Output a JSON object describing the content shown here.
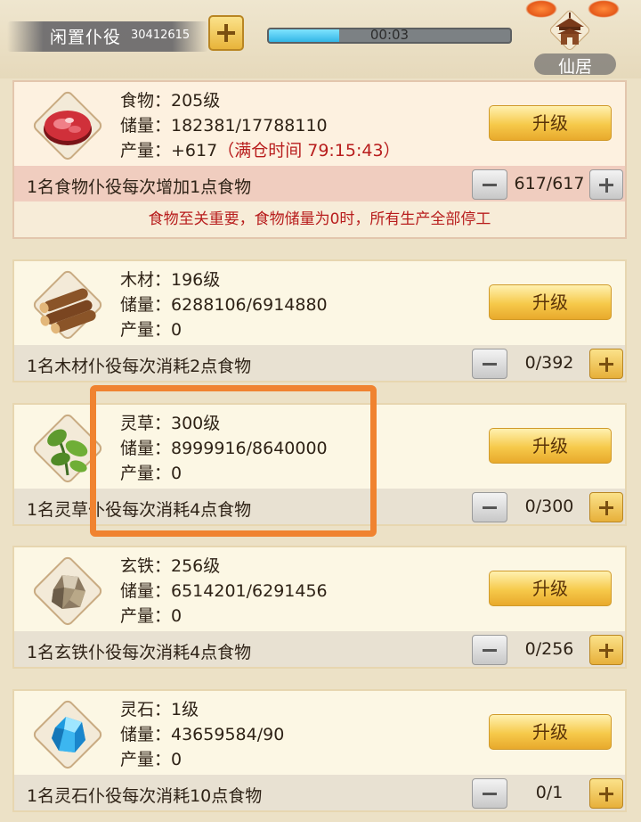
{
  "header": {
    "idle_label": "闲置仆役",
    "idle_count": "30412615",
    "timer": "00:03",
    "timer_progress": 0.29,
    "home_label": "仙居"
  },
  "resources": [
    {
      "name": "food",
      "level": "食物：205级",
      "storage": "储量：182381/17788110",
      "output": "产量：+617",
      "full_time": "（满仓时间 79:15:43）",
      "upgrade": "升级",
      "worker_desc": "1名食物仆役每次增加1点食物",
      "count": "617/617",
      "warning": "食物至关重要，食物储量为0时，所有生产全部停工"
    },
    {
      "name": "wood",
      "level": "木材：196级",
      "storage": "储量：6288106/6914880",
      "output": "产量：0",
      "upgrade": "升级",
      "worker_desc": "1名木材仆役每次消耗2点食物",
      "count": "0/392"
    },
    {
      "name": "herb",
      "level": "灵草：300级",
      "storage": "储量：8999916/8640000",
      "output": "产量：0",
      "upgrade": "升级",
      "worker_desc": "1名灵草仆役每次消耗4点食物",
      "count": "0/300"
    },
    {
      "name": "iron",
      "level": "玄铁：256级",
      "storage": "储量：6514201/6291456",
      "output": "产量：0",
      "upgrade": "升级",
      "worker_desc": "1名玄铁仆役每次消耗4点食物",
      "count": "0/256"
    },
    {
      "name": "stone",
      "level": "灵石：1级",
      "storage": "储量：43659584/90",
      "output": "产量：0",
      "upgrade": "升级",
      "worker_desc": "1名灵石仆役每次消耗10点食物",
      "count": "0/1"
    }
  ],
  "colors": {
    "accent_gold": "#f6c94a",
    "warning_red": "#b81d1d",
    "highlight_orange": "#f08330",
    "timer_blue": "#33b6e6"
  },
  "icons": [
    "meat-icon",
    "wood-logs-icon",
    "herb-leaf-icon",
    "iron-ore-icon",
    "spirit-stone-icon",
    "home-pavilion-icon"
  ]
}
